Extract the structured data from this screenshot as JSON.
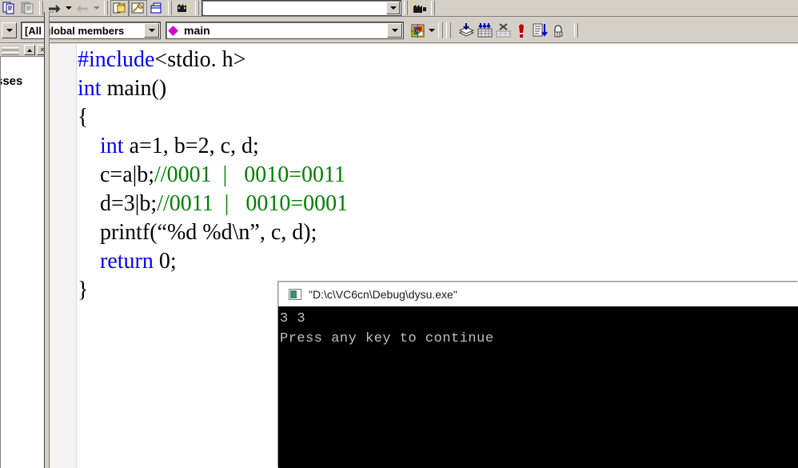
{
  "toolbars": {
    "top": {
      "buttons": [
        {
          "name": "copy-icon",
          "label": "Copy"
        },
        {
          "name": "paste-icon",
          "label": "Paste"
        },
        {
          "name": "undo-icon",
          "label": "Undo"
        },
        {
          "name": "redo-icon",
          "label": "Redo"
        },
        {
          "name": "new-workspace-icon",
          "label": "New Workspace"
        },
        {
          "name": "edit-tool-icon",
          "label": "Edit"
        },
        {
          "name": "window-icon",
          "label": "Window"
        },
        {
          "name": "find-in-files-icon",
          "label": "Find in Files"
        }
      ],
      "find_combo": {
        "value": "",
        "placeholder": ""
      }
    },
    "second": {
      "members_combo": {
        "value": "[All global members"
      },
      "symbol_combo": {
        "value": "main",
        "icon": "magenta-diamond-icon"
      },
      "bookmark_icon": "bookmark-icon",
      "build_buttons": [
        {
          "name": "compile-icon",
          "label": "Compile"
        },
        {
          "name": "build-icon",
          "label": "Build"
        },
        {
          "name": "stop-build-icon",
          "label": "Stop Build"
        },
        {
          "name": "execute-icon",
          "label": "Execute Program"
        },
        {
          "name": "go-icon",
          "label": "Go"
        },
        {
          "name": "insert-breakpoint-icon",
          "label": "Insert/Remove Breakpoint"
        }
      ]
    }
  },
  "workspace": {
    "tab_label": "sses",
    "minimize_button": "▲",
    "close_button": "×"
  },
  "editor": {
    "lines": [
      [
        {
          "t": "#include",
          "c": "k"
        },
        {
          "t": "<stdio. h>",
          "c": "pl"
        }
      ],
      [
        {
          "t": "int",
          "c": "k"
        },
        {
          "t": " main()",
          "c": "pl"
        }
      ],
      [
        {
          "t": "{",
          "c": "pl"
        }
      ],
      [
        {
          "t": "    ",
          "c": "pl"
        },
        {
          "t": "int",
          "c": "k"
        },
        {
          "t": " a=1, b=2, c, d;",
          "c": "pl"
        }
      ],
      [
        {
          "t": "    c=a|b;",
          "c": "pl"
        },
        {
          "t": "//0001  |   0010=0011",
          "c": "cm"
        }
      ],
      [
        {
          "t": "    d=3|b;",
          "c": "pl"
        },
        {
          "t": "//0011  |   0010=0001",
          "c": "cm"
        }
      ],
      [
        {
          "t": "    printf(“%d %d\\n”, c, d);",
          "c": "pl"
        }
      ],
      [
        {
          "t": "    ",
          "c": "pl"
        },
        {
          "t": "return",
          "c": "k"
        },
        {
          "t": " 0;",
          "c": "pl"
        }
      ],
      [
        {
          "t": "}",
          "c": "pl"
        }
      ]
    ],
    "colors": {
      "keyword": "#0000ff",
      "comment": "#008000",
      "plain": "#000000",
      "background": "#ffffff"
    }
  },
  "console": {
    "title": "\"D:\\c\\VC6cn\\Debug\\dysu.exe\"",
    "icon": "console-app-icon",
    "output": [
      "3 3",
      "Press any key to continue"
    ],
    "colors": {
      "background": "#000000",
      "text": "#c0c0c0",
      "titlebar": "#ffffff"
    }
  }
}
